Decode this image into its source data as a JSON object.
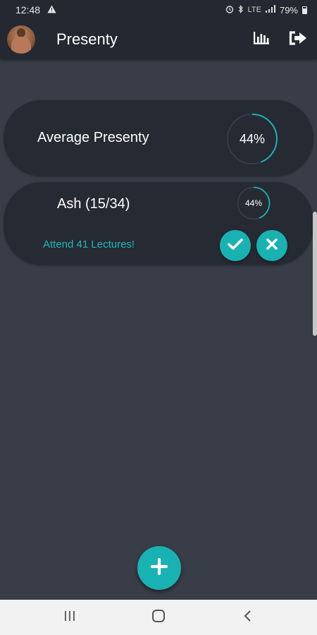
{
  "status_bar": {
    "time": "12:48",
    "network_label": "LTE",
    "battery_percent": "79%",
    "battery_level": 0.79
  },
  "app_bar": {
    "title": "Presenty",
    "avatar_icon": "profile-photo",
    "actions": [
      {
        "icon": "bar-chart-icon"
      },
      {
        "icon": "logout-icon"
      }
    ]
  },
  "average": {
    "label": "Average Presenty",
    "percent_text": "44%",
    "percent_value": 0.44
  },
  "subjects": [
    {
      "name": "Ash (15/34)",
      "percent_text": "44%",
      "percent_value": 0.44,
      "message": "Attend 41 Lectures!"
    }
  ],
  "colors": {
    "accent": "#19b2b2",
    "background": "#383d47",
    "card": "#262a33",
    "toolbar": "#242830",
    "message": "#1fb8b8"
  },
  "fab": {
    "icon": "plus-icon"
  },
  "nav_bar": {
    "icons": [
      "recents-icon",
      "home-icon",
      "back-icon"
    ]
  }
}
